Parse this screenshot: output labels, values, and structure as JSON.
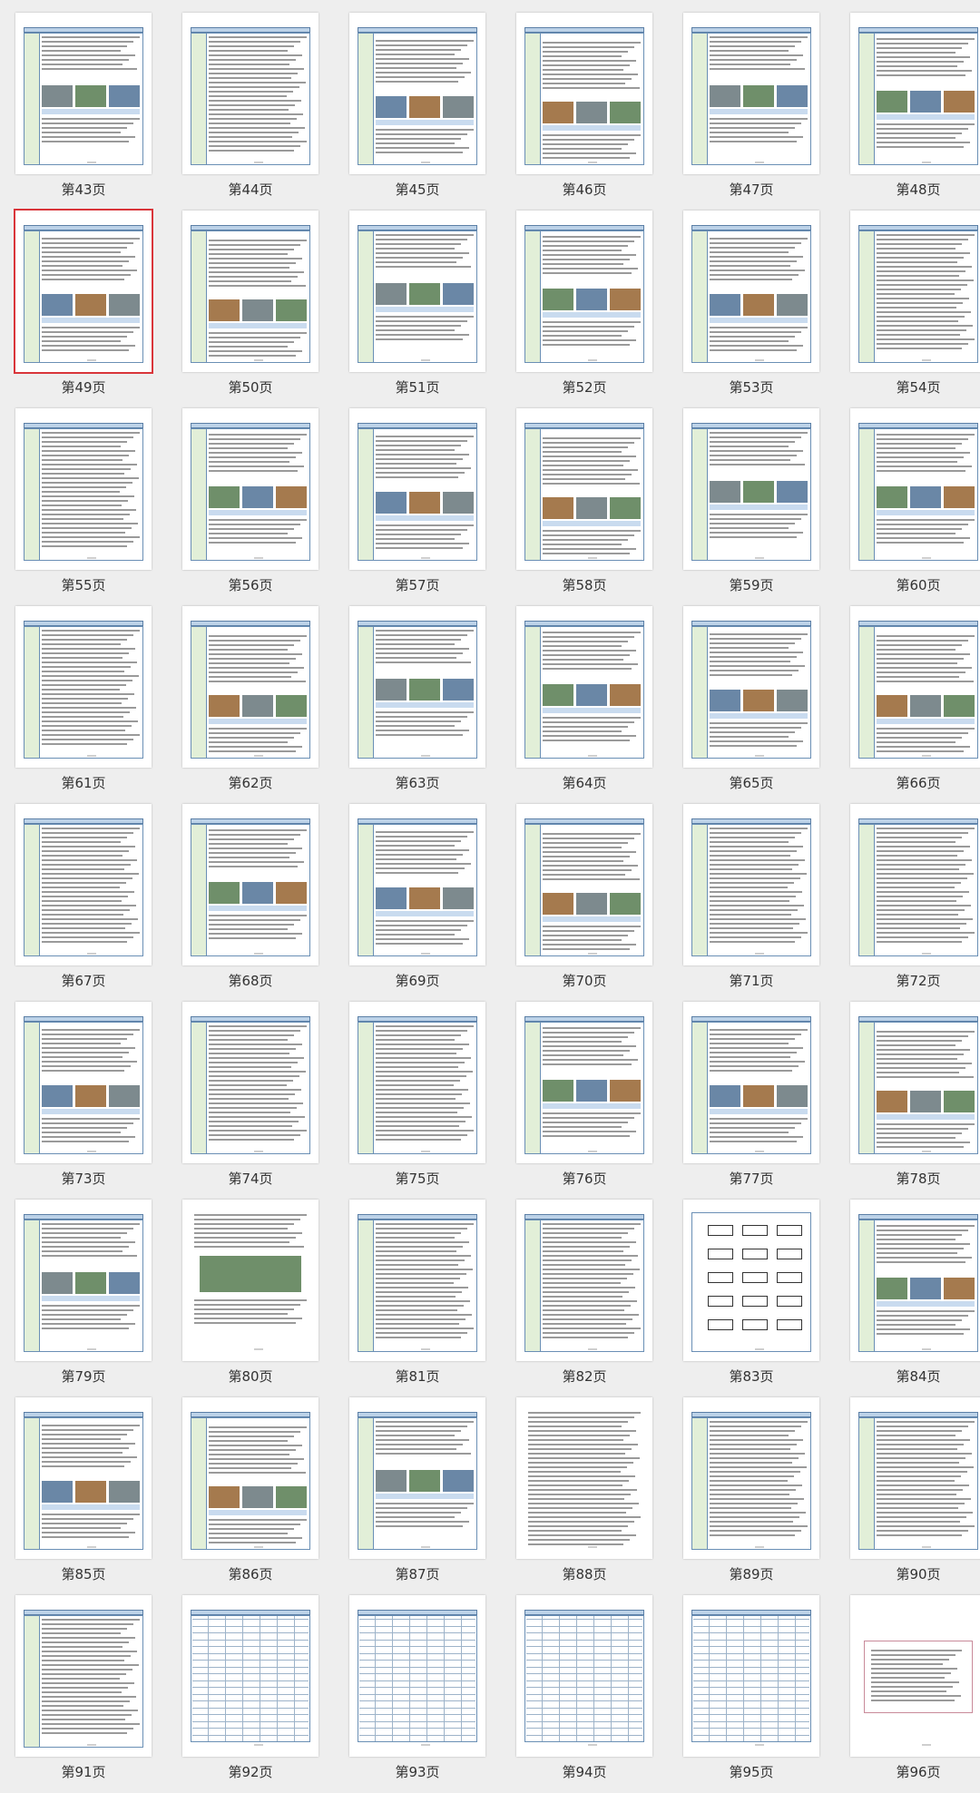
{
  "selected_page": "第49页",
  "accent_color": "#d9353a",
  "pages": [
    {
      "label": "第43页",
      "type": "table-images"
    },
    {
      "label": "第44页",
      "type": "table-text"
    },
    {
      "label": "第45页",
      "type": "table-images"
    },
    {
      "label": "第46页",
      "type": "table-images"
    },
    {
      "label": "第47页",
      "type": "table-images"
    },
    {
      "label": "第48页",
      "type": "table-images"
    },
    {
      "label": "第49页",
      "type": "table-images"
    },
    {
      "label": "第50页",
      "type": "table-images"
    },
    {
      "label": "第51页",
      "type": "table-images"
    },
    {
      "label": "第52页",
      "type": "table-images"
    },
    {
      "label": "第53页",
      "type": "table-images"
    },
    {
      "label": "第54页",
      "type": "table-text"
    },
    {
      "label": "第55页",
      "type": "table-text"
    },
    {
      "label": "第56页",
      "type": "table-images"
    },
    {
      "label": "第57页",
      "type": "table-images"
    },
    {
      "label": "第58页",
      "type": "table-images"
    },
    {
      "label": "第59页",
      "type": "table-images"
    },
    {
      "label": "第60页",
      "type": "table-images"
    },
    {
      "label": "第61页",
      "type": "table-text"
    },
    {
      "label": "第62页",
      "type": "table-images"
    },
    {
      "label": "第63页",
      "type": "table-images"
    },
    {
      "label": "第64页",
      "type": "table-images"
    },
    {
      "label": "第65页",
      "type": "table-images"
    },
    {
      "label": "第66页",
      "type": "table-images"
    },
    {
      "label": "第67页",
      "type": "table-text"
    },
    {
      "label": "第68页",
      "type": "table-images"
    },
    {
      "label": "第69页",
      "type": "table-images"
    },
    {
      "label": "第70页",
      "type": "table-images"
    },
    {
      "label": "第71页",
      "type": "table-text"
    },
    {
      "label": "第72页",
      "type": "table-text"
    },
    {
      "label": "第73页",
      "type": "table-images"
    },
    {
      "label": "第74页",
      "type": "table-text"
    },
    {
      "label": "第75页",
      "type": "table-text"
    },
    {
      "label": "第76页",
      "type": "table-images"
    },
    {
      "label": "第77页",
      "type": "table-images"
    },
    {
      "label": "第78页",
      "type": "table-images"
    },
    {
      "label": "第79页",
      "type": "table-images"
    },
    {
      "label": "第80页",
      "type": "text-images"
    },
    {
      "label": "第81页",
      "type": "table-text"
    },
    {
      "label": "第82页",
      "type": "table-text"
    },
    {
      "label": "第83页",
      "type": "diagram"
    },
    {
      "label": "第84页",
      "type": "table-images"
    },
    {
      "label": "第85页",
      "type": "table-images"
    },
    {
      "label": "第86页",
      "type": "table-images"
    },
    {
      "label": "第87页",
      "type": "table-images"
    },
    {
      "label": "第88页",
      "type": "text"
    },
    {
      "label": "第89页",
      "type": "table-text"
    },
    {
      "label": "第90页",
      "type": "table-text"
    },
    {
      "label": "第91页",
      "type": "table-text"
    },
    {
      "label": "第92页",
      "type": "table"
    },
    {
      "label": "第93页",
      "type": "table"
    },
    {
      "label": "第94页",
      "type": "table"
    },
    {
      "label": "第95页",
      "type": "table"
    },
    {
      "label": "第96页",
      "type": "drawing"
    }
  ]
}
